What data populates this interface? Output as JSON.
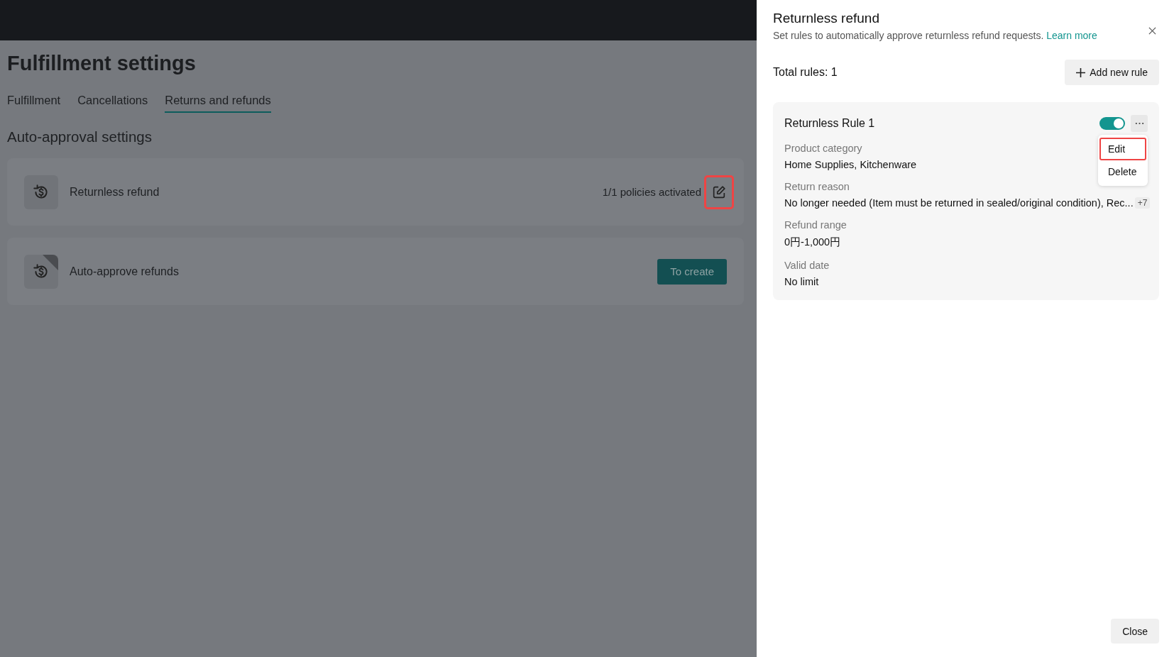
{
  "page": {
    "title": "Fulfillment settings",
    "tabs": [
      {
        "label": "Fulfillment",
        "selected": false
      },
      {
        "label": "Cancellations",
        "selected": false
      },
      {
        "label": "Returns and refunds",
        "selected": true
      }
    ],
    "section_title": "Auto-approval settings",
    "cards": [
      {
        "kind": "status",
        "title": "Returnless refund",
        "status": "1/1 policies activated",
        "highlighted": true
      },
      {
        "kind": "create",
        "title": "Auto-approve refunds",
        "button": "To create",
        "ribbon": true
      }
    ]
  },
  "drawer": {
    "title": "Returnless refund",
    "description": "Set rules to automatically approve returnless refund requests.",
    "link": "Learn more",
    "total": "Total rules: 1",
    "add_button": "Add new rule",
    "rules": [
      {
        "name": "Returnless Rule 1",
        "enabled": true,
        "menu": [
          {
            "label": "Edit",
            "highlighted": true
          },
          {
            "label": "Delete",
            "highlighted": false
          }
        ],
        "fields": [
          {
            "label": "Product category",
            "value": "Home Supplies, Kitchenware"
          },
          {
            "label": "Return reason",
            "value": "No longer needed (Item must be returned in sealed/original condition), Rec...",
            "more": "+7"
          },
          {
            "label": "Refund range",
            "value": "0円-1,000円"
          },
          {
            "label": "Valid date",
            "value": "No limit"
          }
        ]
      }
    ],
    "close_button": "Close"
  }
}
